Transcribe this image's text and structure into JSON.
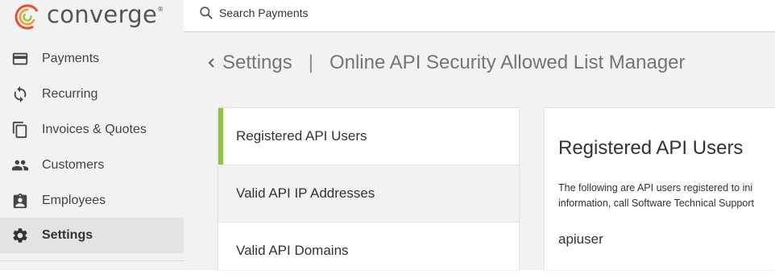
{
  "brand": {
    "name": "converge",
    "trademark": "®",
    "colors": {
      "accent": "#8cc63f",
      "logo_orange": "#e8522a",
      "logo_green": "#8cc63f"
    }
  },
  "search": {
    "placeholder": "Search Payments",
    "value": "",
    "icon": "search-icon"
  },
  "sidebar": {
    "items": [
      {
        "label": "Payments",
        "icon": "credit-card-icon",
        "active": false
      },
      {
        "label": "Recurring",
        "icon": "refresh-icon",
        "active": false
      },
      {
        "label": "Invoices & Quotes",
        "icon": "copy-icon",
        "active": false
      },
      {
        "label": "Customers",
        "icon": "people-icon",
        "active": false
      },
      {
        "label": "Employees",
        "icon": "badge-icon",
        "active": false
      },
      {
        "label": "Settings",
        "icon": "gear-icon",
        "active": true
      }
    ]
  },
  "breadcrumb": {
    "parent": "Settings",
    "separator": "|",
    "current": "Online API Security Allowed List Manager"
  },
  "list": {
    "items": [
      {
        "label": "Registered API Users",
        "selected": true
      },
      {
        "label": "Valid API IP Addresses",
        "selected": false
      },
      {
        "label": "Valid API Domains",
        "selected": false
      }
    ]
  },
  "detail": {
    "title": "Registered API Users",
    "description_line1": "The following are API users registered to ini",
    "description_line2": "information, call Software Technical Support",
    "users": [
      "apiuser"
    ]
  }
}
